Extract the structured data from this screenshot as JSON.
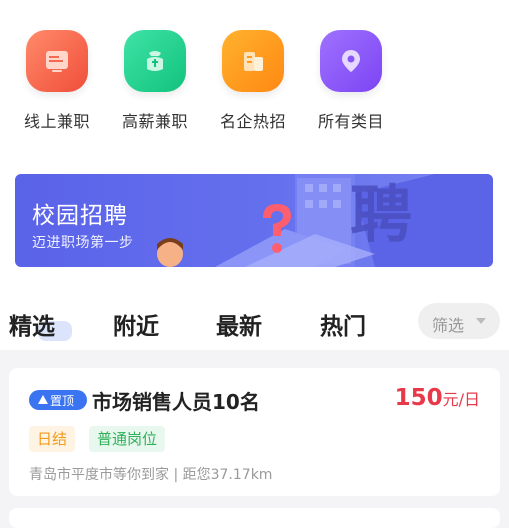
{
  "categories": [
    {
      "label": "线上兼职",
      "icon": "online-job-icon",
      "color_from": "#ff8a6a",
      "color_to": "#f04e3a"
    },
    {
      "label": "高薪兼职",
      "icon": "high-pay-icon",
      "color_from": "#3fe3a6",
      "color_to": "#12c27d"
    },
    {
      "label": "名企热招",
      "icon": "famous-company-icon",
      "color_from": "#ffb22e",
      "color_to": "#ff8812"
    },
    {
      "label": "所有类目",
      "icon": "all-categories-icon",
      "color_from": "#a071ff",
      "color_to": "#7b45f3"
    }
  ],
  "banner": {
    "title": "校园招聘",
    "subtitle": "迈进职场第一步",
    "art_char": "聘"
  },
  "tabs": [
    {
      "label": "精选",
      "active": true
    },
    {
      "label": "附近",
      "active": false
    },
    {
      "label": "最新",
      "active": false
    },
    {
      "label": "热门",
      "active": false
    }
  ],
  "filter": {
    "label": "筛选"
  },
  "job": {
    "pin_label": "置顶",
    "title": "市场销售人员10名",
    "salary_amount": "150",
    "salary_unit": "元/日",
    "tags": [
      "日结",
      "普通岗位"
    ],
    "location": "青岛市平度市等你到家 | 距您37.17km"
  },
  "colors": {
    "accent_blue": "#3b74f0",
    "price_red": "#e8394b",
    "banner_blue": "#5a63e8"
  }
}
